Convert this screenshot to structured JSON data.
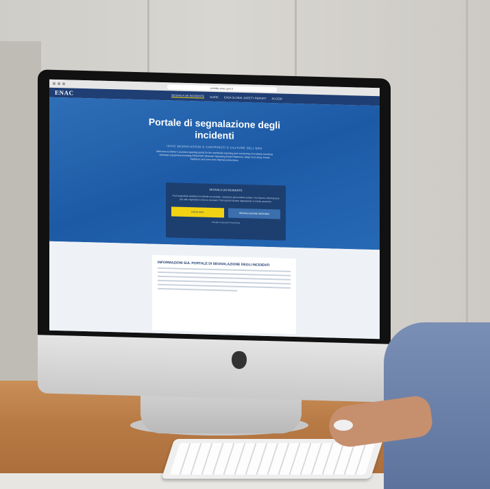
{
  "browser": {
    "url": "portale.enac.gov.it"
  },
  "site": {
    "logo": "ENAC",
    "nav": [
      "SEGNALA UN INCIDENTE",
      "GUIDE",
      "EASA GLOBAL SAFETY REPORT",
      "ACCEDI"
    ]
  },
  "hero": {
    "title": "Portale di segnalazione degli incidenti",
    "subtitle": "Invio segnalazioni e contributi e culture dell'era",
    "body": "Welcome to ENAC's accident reporting portal for the worldwide reporting and monitoring of incidents involving Ukrainian equipment including RPAS/ASR (Remote Operating Aerial Platforms). Maps from Entry Points Platforms and ones from internal productions."
  },
  "card": {
    "title": "SEGNALA UN INCIDENTE",
    "text": "Puoi segnalare qualsiasi incidente sul portale, compreso gli incidenti aviator. Per favore, informazioni più utili, registrati e crea un account. Puoi quindi iniziare segnalando in modo anonimo.",
    "primary_button": "INIZIA ORA",
    "secondary_button": "SEGNALAZIONE ANONIMA",
    "link": "Hai già un account? Accedi qui"
  },
  "info": {
    "title": "INFORMAZIONI SUL PORTALE DI SEGNALAZIONE DEGLI INCIDENTI"
  }
}
